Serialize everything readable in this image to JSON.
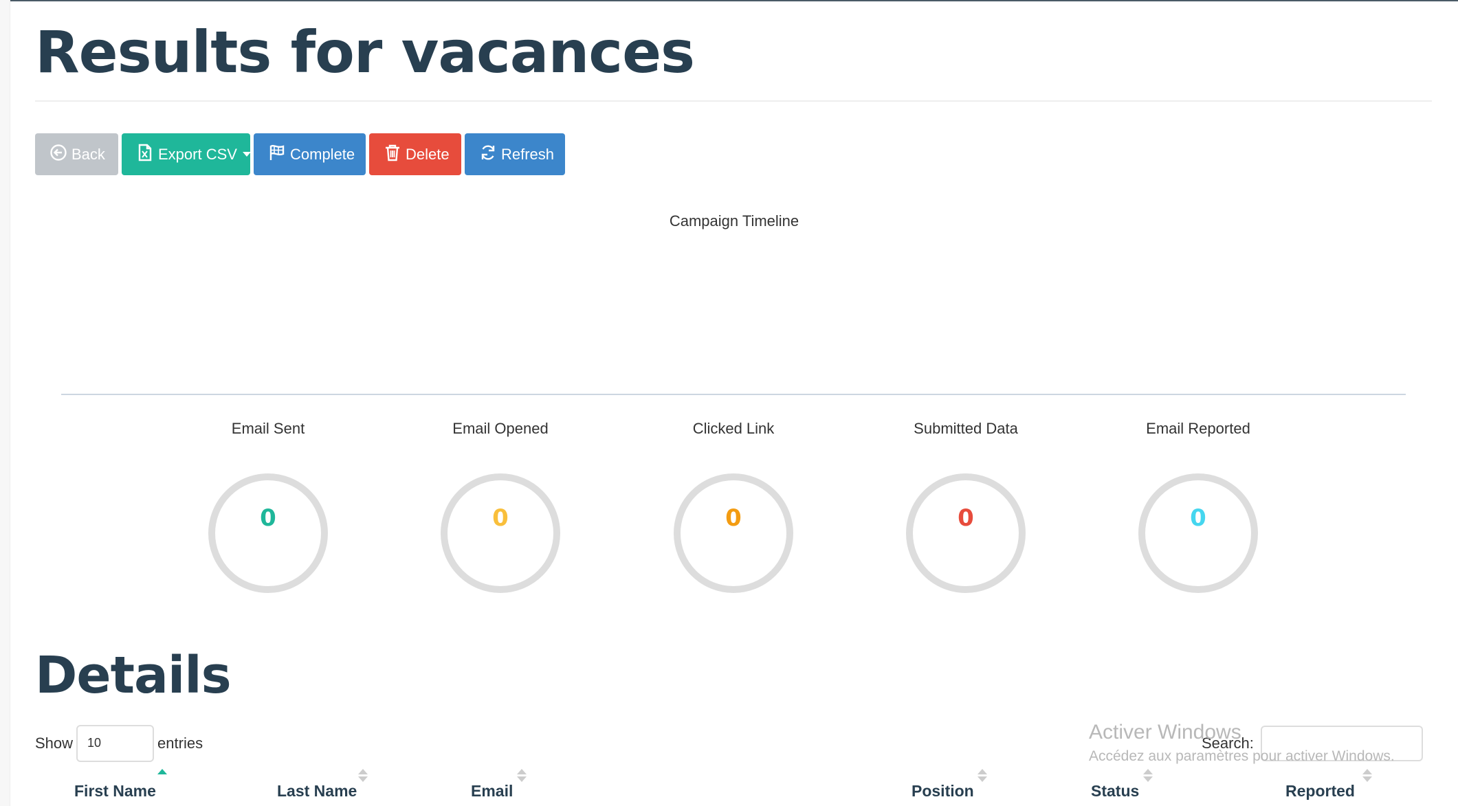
{
  "page": {
    "title": "Results for vacances"
  },
  "toolbar": {
    "back_label": "Back",
    "export_label": "Export CSV",
    "complete_label": "Complete",
    "delete_label": "Delete",
    "refresh_label": "Refresh"
  },
  "timeline": {
    "title": "Campaign Timeline"
  },
  "stats": [
    {
      "label": "Email Sent",
      "value": "0",
      "color": "#1fb79a"
    },
    {
      "label": "Email Opened",
      "value": "0",
      "color": "#f9bf3b"
    },
    {
      "label": "Clicked Link",
      "value": "0",
      "color": "#f39c12"
    },
    {
      "label": "Submitted Data",
      "value": "0",
      "color": "#e74c3c"
    },
    {
      "label": "Email Reported",
      "value": "0",
      "color": "#45d6ef"
    }
  ],
  "details": {
    "title": "Details",
    "show_label": "Show",
    "page_size": "10",
    "entries_label": "entries",
    "search_label": "Search:",
    "columns": [
      "First Name",
      "Last Name",
      "Email",
      "Position",
      "Status",
      "Reported"
    ]
  },
  "watermark": {
    "line1": "Activer Windows",
    "line2": "Accédez aux paramètres pour activer Windows."
  }
}
